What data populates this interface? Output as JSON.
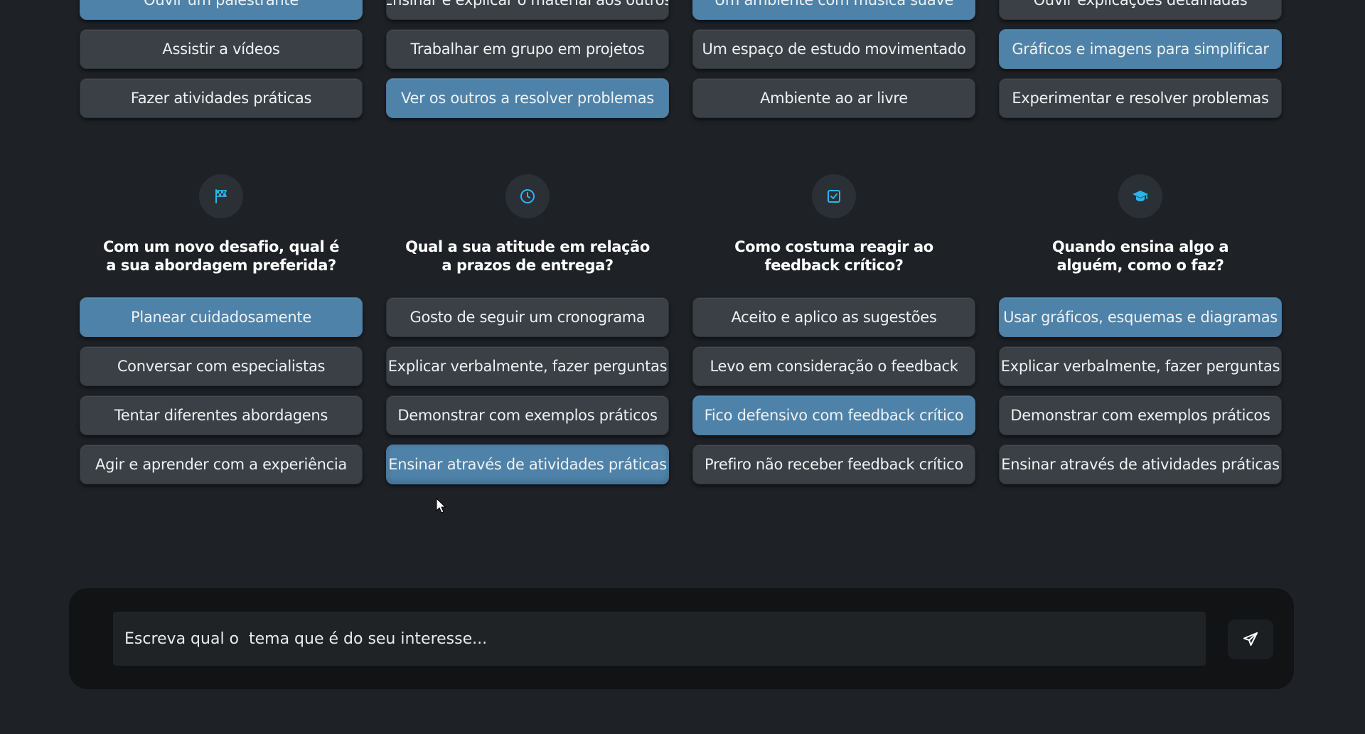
{
  "colors": {
    "background": "#1e2227",
    "option_default": "#3a4045",
    "option_selected": "#4f82a8",
    "icon_accent": "#2bb6ea"
  },
  "top_section": {
    "row0": [
      {
        "label": "Ouvir um palestrante",
        "selected": true
      },
      {
        "label": "Ensinar e explicar o material aos outros",
        "selected": false
      },
      {
        "label": "Um ambiente com música suave",
        "selected": true
      },
      {
        "label": "Ouvir explicações detalhadas",
        "selected": false
      }
    ],
    "row1": [
      {
        "label": "Assistir a vídeos",
        "selected": false
      },
      {
        "label": "Trabalhar em grupo em projetos",
        "selected": false
      },
      {
        "label": "Um espaço de estudo movimentado",
        "selected": false
      },
      {
        "label": "Gráficos e imagens para simplificar",
        "selected": true
      }
    ],
    "row2": [
      {
        "label": "Fazer atividades práticas",
        "selected": false
      },
      {
        "label": "Ver os outros a resolver problemas",
        "selected": true
      },
      {
        "label": "Ambiente ao ar livre",
        "selected": false
      },
      {
        "label": "Experimentar e resolver problemas",
        "selected": false
      }
    ]
  },
  "questions": [
    {
      "icon": "flag-checkered-icon",
      "title_line1": "Com um novo desafio, qual é",
      "title_line2": "a sua abordagem preferida?",
      "options": [
        {
          "label": "Planear cuidadosamente",
          "selected": true
        },
        {
          "label": "Conversar com especialistas",
          "selected": false
        },
        {
          "label": "Tentar diferentes abordagens",
          "selected": false
        },
        {
          "label": "Agir e aprender com a experiência",
          "selected": false
        }
      ]
    },
    {
      "icon": "clock-icon",
      "title_line1": "Qual a sua atitude em relação",
      "title_line2": "a prazos de entrega?",
      "options": [
        {
          "label": "Gosto de seguir um cronograma",
          "selected": false
        },
        {
          "label": "Explicar verbalmente, fazer perguntas",
          "selected": false
        },
        {
          "label": "Demonstrar com exemplos práticos",
          "selected": false
        },
        {
          "label": "Ensinar através de atividades práticas",
          "selected": true
        }
      ]
    },
    {
      "icon": "checkbox-icon",
      "title_line1": "Como costuma reagir ao",
      "title_line2": "feedback crítico?",
      "options": [
        {
          "label": "Aceito e aplico as sugestões",
          "selected": false
        },
        {
          "label": "Levo em consideração o feedback",
          "selected": false
        },
        {
          "label": "Fico defensivo com feedback crítico",
          "selected": true
        },
        {
          "label": "Prefiro não receber feedback crítico",
          "selected": false
        }
      ]
    },
    {
      "icon": "graduation-cap-icon",
      "title_line1": "Quando ensina algo a",
      "title_line2": "alguém, como o faz?",
      "options": [
        {
          "label": "Usar gráficos, esquemas e diagramas",
          "selected": true
        },
        {
          "label": "Explicar verbalmente, fazer perguntas",
          "selected": false
        },
        {
          "label": "Demonstrar com exemplos práticos",
          "selected": false
        },
        {
          "label": "Ensinar através de atividades práticas",
          "selected": false
        }
      ]
    }
  ],
  "chat": {
    "placeholder": "Escreva qual o  tema que é do seu interesse...",
    "send_icon": "send-icon"
  }
}
